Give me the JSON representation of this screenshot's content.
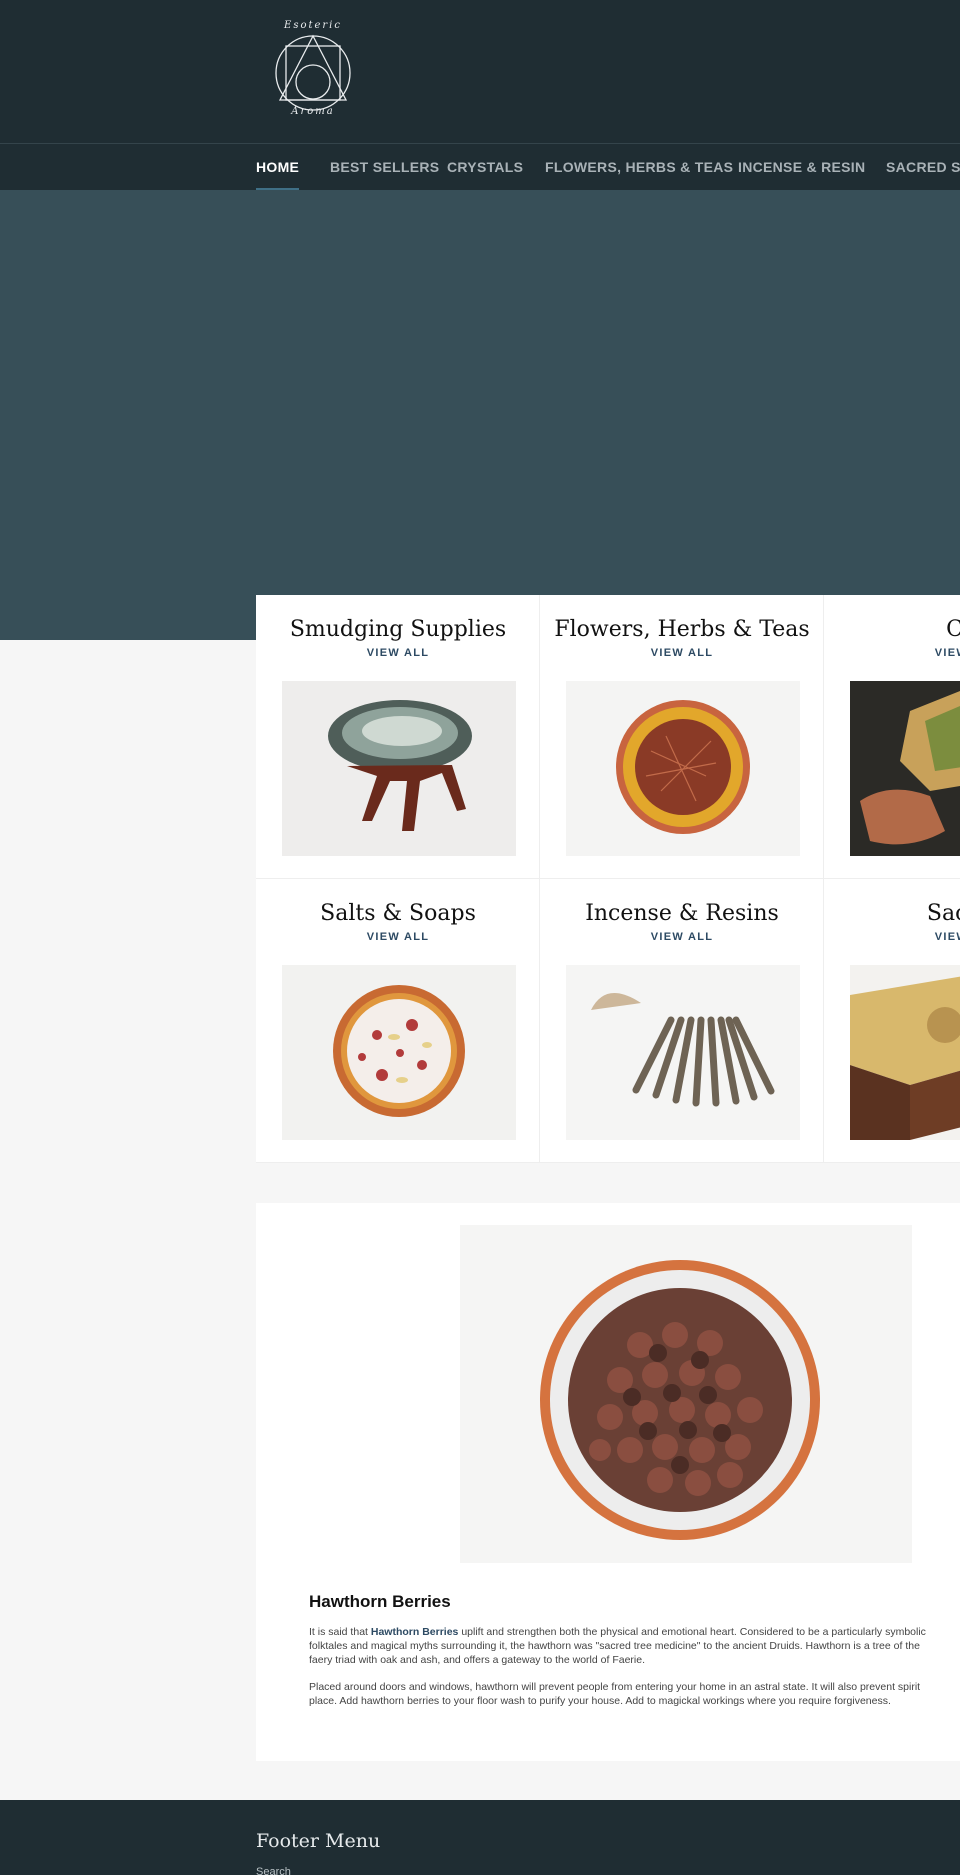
{
  "header": {
    "logo": {
      "top_text": "Esoteric",
      "bottom_text": "Aroma"
    }
  },
  "nav": {
    "items": [
      {
        "label": "HOME",
        "active": true
      },
      {
        "label": "BEST SELLERS",
        "active": false
      },
      {
        "label": "CRYSTALS",
        "active": false
      },
      {
        "label": "FLOWERS, HERBS & TEAS",
        "active": false
      },
      {
        "label": "INCENSE & RESIN",
        "active": false
      },
      {
        "label": "SACRED SP",
        "active": false
      }
    ]
  },
  "collections": {
    "view_all_label": "VIEW ALL",
    "items": [
      {
        "title": "Smudging Supplies",
        "image": "abalone-shell-on-stand"
      },
      {
        "title": "Flowers, Herbs & Teas",
        "image": "dried-herbs-in-bowl"
      },
      {
        "title": "Cry",
        "image": "crystal-in-hand"
      },
      {
        "title": "Salts & Soaps",
        "image": "bath-salts-in-bowl"
      },
      {
        "title": "Incense & Resins",
        "image": "incense-sticks"
      },
      {
        "title": "Sacred",
        "image": "wooden-box"
      }
    ]
  },
  "feature": {
    "title": "Hawthorn Berries",
    "image": "hawthorn-berries-in-bowl",
    "p1_before": "It is said that ",
    "p1_link": "Hawthorn Berries",
    "p1_after": " uplift and strengthen both the physical and emotional heart. Considered to be a particularly symbolic",
    "p1_line2": "folktales and magical myths surrounding it, the hawthorn was \"sacred tree medicine\" to the ancient Druids. Hawthorn is a tree of the",
    "p1_line3": "faery triad with oak and ash, and offers a gateway to the world of Faerie.",
    "p2_line1": "Placed around doors and windows, hawthorn will prevent people from entering your home in an astral state. It will also prevent spirit",
    "p2_line2": "place. Add hawthorn berries to your floor wash to purify your house. Add to magickal workings where you require forgiveness."
  },
  "footer": {
    "title": "Footer Menu",
    "link": "Search"
  },
  "colors": {
    "header_bg": "#1f2d33",
    "hero_bg": "#374f58",
    "page_bg": "#f6f6f6",
    "accent_link": "#2d4a63"
  }
}
